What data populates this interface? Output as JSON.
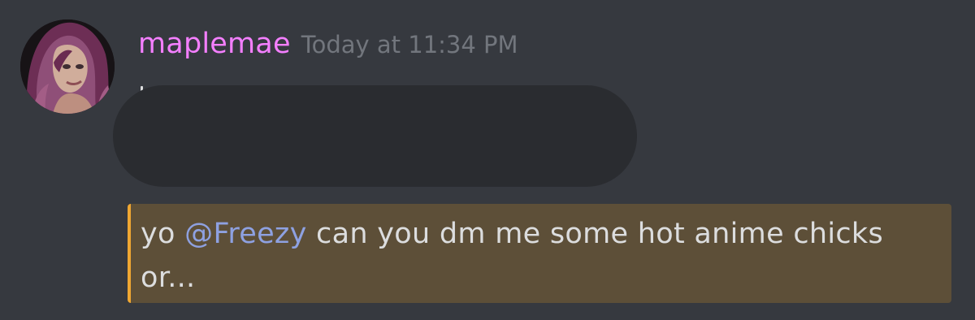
{
  "message": {
    "author": "maplemae",
    "timestamp": "Today at 11:34 PM",
    "text_part_1": "yo ",
    "mention": "@Freezy",
    "text_part_2": " can you dm me some hot anime chicks or..."
  },
  "colors": {
    "background": "#36393f",
    "username": "#f47fff",
    "mention": "#8ea1e1",
    "highlight_background": "#5d4f38",
    "highlight_border": "#f0a732",
    "redaction": "#2a2c30"
  },
  "icons": {
    "avatar": "user-avatar"
  }
}
